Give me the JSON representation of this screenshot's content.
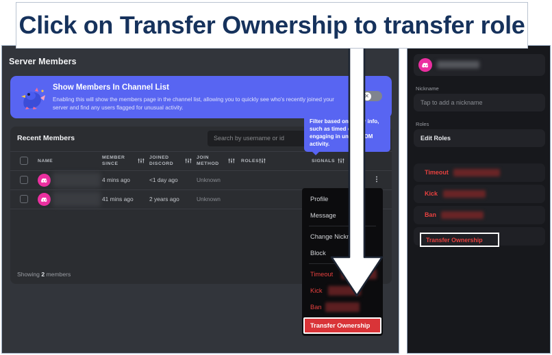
{
  "caption": {
    "text": "Click on Transfer Ownership to transfer role"
  },
  "left_panel": {
    "page_title": "Server Members",
    "promo": {
      "title": "Show Members In Channel List",
      "description": "Enabling this will show the members page in the channel list, allowing you to quickly see who's recently joined your server and find any users flagged for unusual activity.",
      "toggle_state": "off",
      "toggle_icon": "close-x-icon"
    },
    "members": {
      "section_label": "Recent Members",
      "search_placeholder": "Search by username or id",
      "search_value": "",
      "search_icon": "search-icon",
      "columns": [
        {
          "label": "NAME",
          "filter_icon": false
        },
        {
          "label": "MEMBER SINCE",
          "filter_icon": true
        },
        {
          "label": "JOINED DISCORD",
          "filter_icon": true
        },
        {
          "label": "JOIN METHOD",
          "filter_icon": true
        },
        {
          "label": "ROLES",
          "filter_icon": true
        },
        {
          "label": "SIGNALS",
          "filter_icon": true
        }
      ],
      "rows": [
        {
          "avatar_icon": "discord-avatar-icon",
          "name": "",
          "member_since": "4 mins ago",
          "joined_discord": "<1 day ago",
          "join_method": "Unknown",
          "roles": "",
          "signals": ""
        },
        {
          "avatar_icon": "discord-avatar-icon",
          "name": "",
          "member_since": "41 mins ago",
          "joined_discord": "2 years ago",
          "join_method": "Unknown",
          "roles": "",
          "signals": ""
        }
      ],
      "footer_prefix": "Showing ",
      "footer_count": "2",
      "footer_suffix": " members"
    }
  },
  "tooltip": {
    "text": "Filter based on safety info, such as timed out or engaging in unusual DM activity."
  },
  "context_menu": {
    "items": [
      {
        "label": "Profile",
        "danger": false
      },
      {
        "label": "Message",
        "danger": false
      },
      {
        "label": "Change Nickname",
        "danger": false
      },
      {
        "label": "Block",
        "danger": false
      },
      {
        "label": "Timeout",
        "danger": true
      },
      {
        "label": "Kick",
        "danger": true
      },
      {
        "label": "Ban",
        "danger": true
      }
    ],
    "highlighted_item": "Transfer Ownership"
  },
  "right_panel": {
    "user_name": "",
    "user_avatar_icon": "discord-avatar-icon",
    "nickname_label": "Nickname",
    "nickname_placeholder": "Tap to add a nickname",
    "roles_label": "Roles",
    "edit_roles_label": "Edit Roles",
    "actions": [
      {
        "label": "Timeout"
      },
      {
        "label": "Kick"
      },
      {
        "label": "Ban"
      }
    ],
    "highlighted_action": "Transfer Ownership"
  },
  "colors": {
    "accent_blurple": "#5865f2",
    "danger_red": "#e8413f",
    "highlight_red": "#d93438",
    "avatar_pink": "#eb2fa0",
    "caption_navy": "#16325c",
    "panel_bg": "#32353b",
    "card_bg": "#2b2d31",
    "right_panel_bg": "#17181c"
  }
}
